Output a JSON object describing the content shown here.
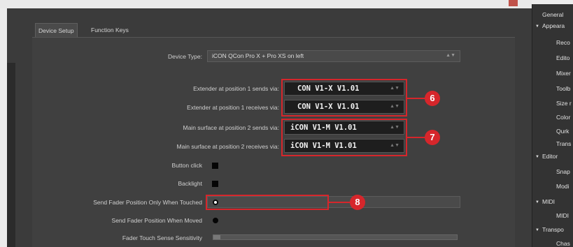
{
  "window": {
    "title": ""
  },
  "tabs": [
    {
      "label": "Device Setup",
      "active": true
    },
    {
      "label": "Function Keys",
      "active": false
    }
  ],
  "device_type": {
    "label": "Device Type:",
    "value": "iCON QCon Pro X + Pro XS on left"
  },
  "mappings": [
    {
      "label": "Extender at position 1 sends via:",
      "value": "CON V1-X V1.01"
    },
    {
      "label": "Extender at position 1 receives via:",
      "value": "CON V1-X V1.01"
    },
    {
      "label": "Main surface at position 2 sends via:",
      "value": "iCON V1-M V1.01"
    },
    {
      "label": "Main surface at position 2 receives via:",
      "value": "iCON V1-M V1.01"
    }
  ],
  "options": {
    "button_click": {
      "label": "Button click",
      "checked": true
    },
    "backlight": {
      "label": "Backlight",
      "checked": true
    },
    "fader_touched": {
      "label": "Send Fader Position Only When Touched",
      "selected": true
    },
    "fader_moved": {
      "label": "Send Fader Position When Moved",
      "selected": false
    },
    "sensitivity": {
      "label": "Fader Touch Sense Sensitivity",
      "value": 0.03
    }
  },
  "callouts": [
    "6",
    "7",
    "8"
  ],
  "sidebar": {
    "items": [
      {
        "label": "General"
      },
      {
        "label": "Appeara"
      },
      {
        "label": "Reco"
      },
      {
        "label": "Edito"
      },
      {
        "label": "Mixer"
      },
      {
        "label": "Toolb"
      },
      {
        "label": "Size r"
      },
      {
        "label": "Color"
      },
      {
        "label": "Qurk"
      },
      {
        "label": "Trans"
      },
      {
        "label": "Editor"
      },
      {
        "label": "Snap"
      },
      {
        "label": "Modi"
      },
      {
        "label": "MIDI"
      },
      {
        "label": "MIDI"
      },
      {
        "label": "Transpo"
      },
      {
        "label": "Chas"
      }
    ]
  },
  "colors": {
    "highlight": "#d6262b",
    "panel": "#3b3b3b",
    "sidebar": "#333333"
  }
}
